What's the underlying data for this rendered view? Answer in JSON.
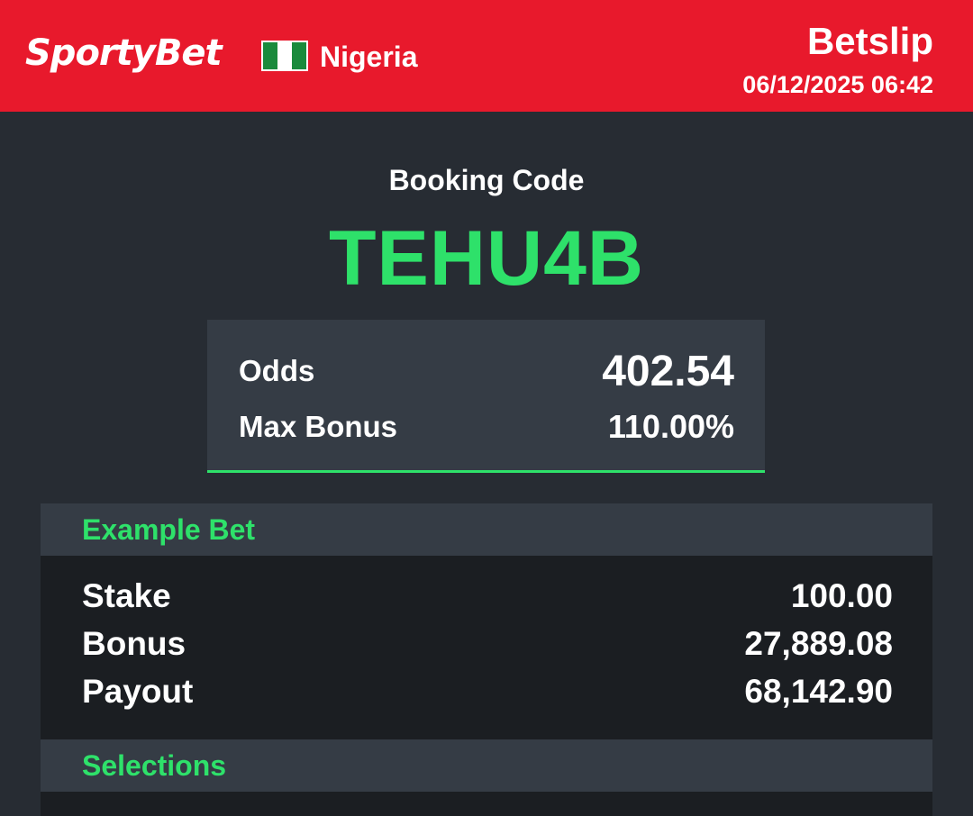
{
  "header": {
    "logo": "SportyBet",
    "country": "Nigeria",
    "title": "Betslip",
    "datetime": "06/12/2025 06:42",
    "flag_colors": [
      "#1a8a3c",
      "#ffffff",
      "#1a8a3c"
    ]
  },
  "booking": {
    "label": "Booking Code",
    "code": "TEHU4B"
  },
  "summary": {
    "odds_label": "Odds",
    "odds_value": "402.54",
    "max_bonus_label": "Max Bonus",
    "max_bonus_value": "110.00%"
  },
  "example_bet": {
    "title": "Example Bet",
    "rows": [
      {
        "label": "Stake",
        "value": "100.00"
      },
      {
        "label": "Bonus",
        "value": "27,889.08"
      },
      {
        "label": "Payout",
        "value": "68,142.90"
      }
    ]
  },
  "selections": {
    "title": "Selections"
  },
  "colors": {
    "brand_red": "#e8192c",
    "accent_green": "#2ee16a",
    "background": "#272c33",
    "card": "#353c45",
    "panel_dark": "#1b1e22"
  }
}
